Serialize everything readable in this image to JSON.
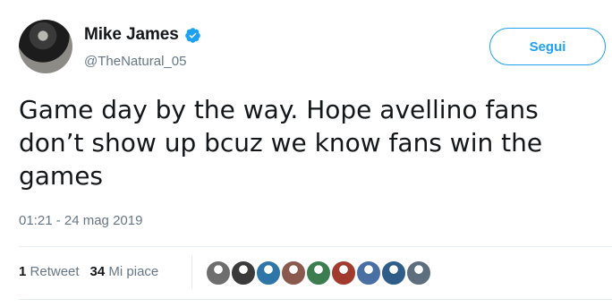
{
  "user": {
    "name": "Mike James",
    "handle": "@TheNatural_05",
    "verified_icon": "verified-badge-icon"
  },
  "follow_button": {
    "label": "Segui"
  },
  "tweet": {
    "text": "Game day by the way. Hope avellino fans don’t show up bcuz we know fans win the games",
    "timestamp": "01:21 - 24 mag 2019"
  },
  "stats": {
    "retweets_count": "1",
    "retweets_label": "Retweet",
    "likes_count": "34",
    "likes_label": "Mi piace"
  },
  "colors": {
    "accent": "#1da1f2",
    "muted_text": "#657786",
    "divider": "#e6ecf0"
  },
  "likers": [
    {
      "name": "liker-avatar-1",
      "color": "#6e6e6e"
    },
    {
      "name": "liker-avatar-2",
      "color": "#3b3b3b"
    },
    {
      "name": "liker-avatar-3",
      "color": "#2f76a8"
    },
    {
      "name": "liker-avatar-4",
      "color": "#8a5a4e"
    },
    {
      "name": "liker-avatar-5",
      "color": "#3b7d4f"
    },
    {
      "name": "liker-avatar-6",
      "color": "#a33a2e"
    },
    {
      "name": "liker-avatar-7",
      "color": "#4a6fa5"
    },
    {
      "name": "liker-avatar-8",
      "color": "#2e5d8a"
    },
    {
      "name": "liker-avatar-9",
      "color": "#5d6f7f"
    }
  ]
}
